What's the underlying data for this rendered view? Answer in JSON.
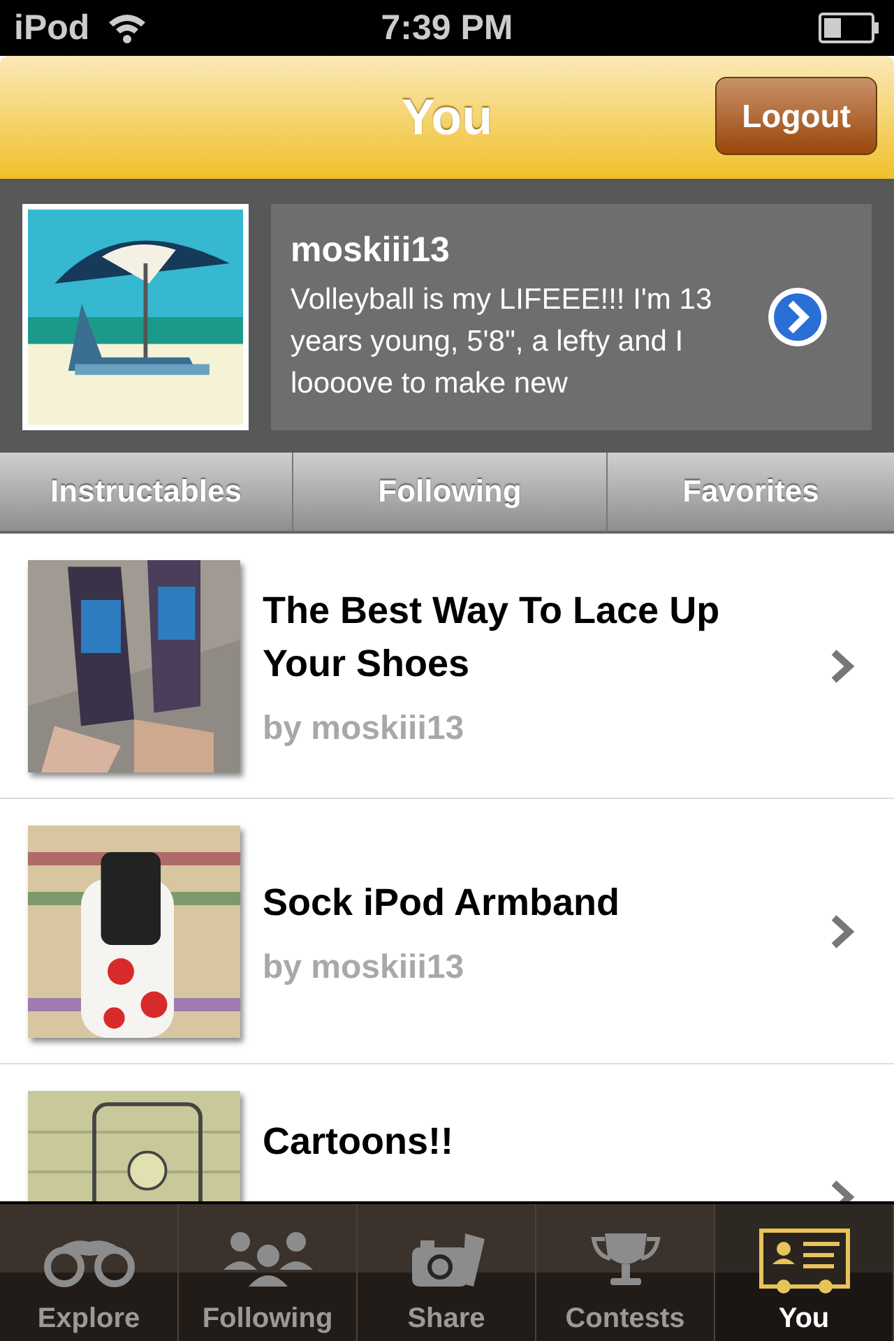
{
  "status_bar": {
    "carrier": "iPod",
    "time": "7:39 PM"
  },
  "nav_bar": {
    "title": "You",
    "button": "Logout"
  },
  "profile": {
    "username": "moskiii13",
    "bio": "Volleyball is my LIFEEE!!! I'm 13 years young, 5'8\", a lefty and I loooove to make new"
  },
  "segments": [
    {
      "label": "Instructables",
      "selected": false
    },
    {
      "label": "Following",
      "selected": false
    },
    {
      "label": "Favorites",
      "selected": false
    }
  ],
  "items": [
    {
      "title": "The Best Way To Lace Up Your Shoes",
      "byline": "by moskiii13"
    },
    {
      "title": "Sock iPod Armband",
      "byline": "by moskiii13"
    },
    {
      "title": "Cartoons!!"
    }
  ],
  "tab_bar": [
    {
      "label": "Explore",
      "selected": false
    },
    {
      "label": "Following",
      "selected": false
    },
    {
      "label": "Share",
      "selected": false
    },
    {
      "label": "Contests",
      "selected": false
    },
    {
      "label": "You",
      "selected": true
    }
  ]
}
